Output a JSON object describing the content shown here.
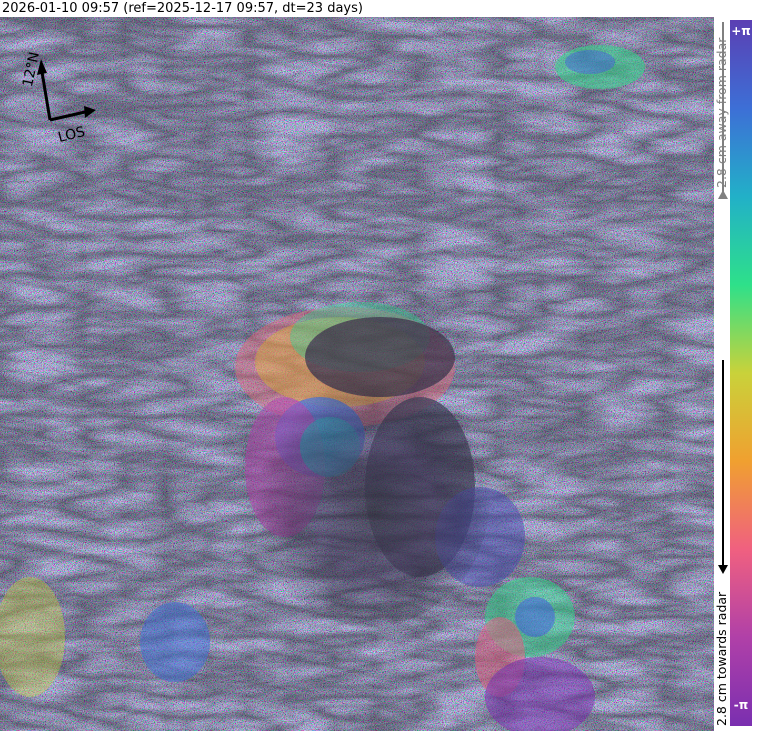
{
  "title": "2026-01-10 09:57 (ref=2025-12-17 09:57, dt=23 days)",
  "compass": {
    "north_label": "12°N",
    "los_label": "LOS"
  },
  "colorbar": {
    "top_label": "+π",
    "bottom_label": "-π",
    "away_label": "2.8 cm away from radar",
    "towards_label": "2.8 cm towards radar",
    "colors": [
      "#5b3fb3",
      "#3d6fd6",
      "#22b0c8",
      "#2ee08a",
      "#c9d23a",
      "#f0a030",
      "#f06080",
      "#b040a8",
      "#7a2fb0"
    ]
  },
  "image": {
    "description_icon": "interferogram-volcano"
  }
}
